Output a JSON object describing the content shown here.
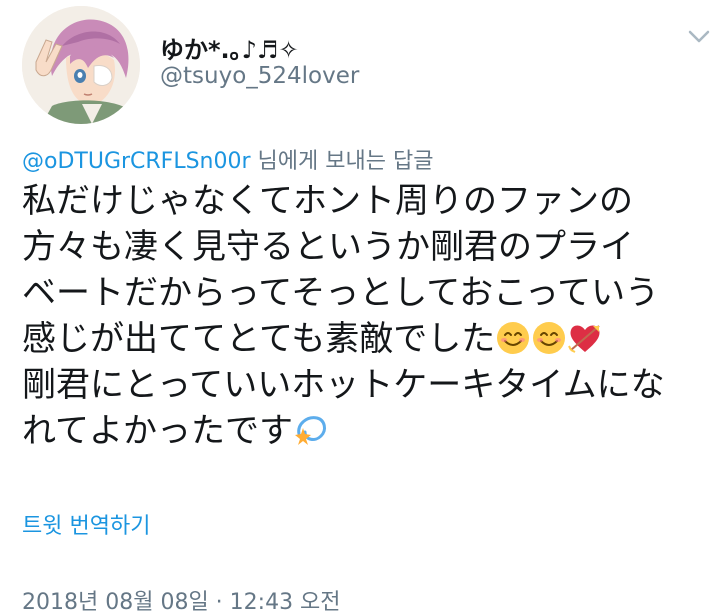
{
  "user": {
    "display_name": "ゆか*.｡♪♬✧",
    "handle": "@tsuyo_524lover"
  },
  "reply": {
    "mention": "@oDTUGrCRFLSn00r",
    "suffix": " 님에게 보내는 답글"
  },
  "tweet": {
    "line1": "私だけじゃなくてホント周りのファンの",
    "line2": "方々も凄く見守るというか剛君のプライ",
    "line3": "ベートだからってそっとしておこっていう",
    "line4": "感じが出ててとても素敵でした",
    "line5": "剛君にとっていいホットケーキタイムにな",
    "line6": "れてよかったです",
    "emojis": [
      "smiling-face-emoji",
      "smiling-face-emoji",
      "heart-arrow-emoji",
      "dizzy-emoji"
    ]
  },
  "actions": {
    "translate_label": "트윗 번역하기"
  },
  "meta": {
    "timestamp": "2018년 08월 08일 · 12:43 오전"
  },
  "colors": {
    "link": "#1b95e0",
    "secondary": "#657786",
    "text": "#14171a"
  }
}
